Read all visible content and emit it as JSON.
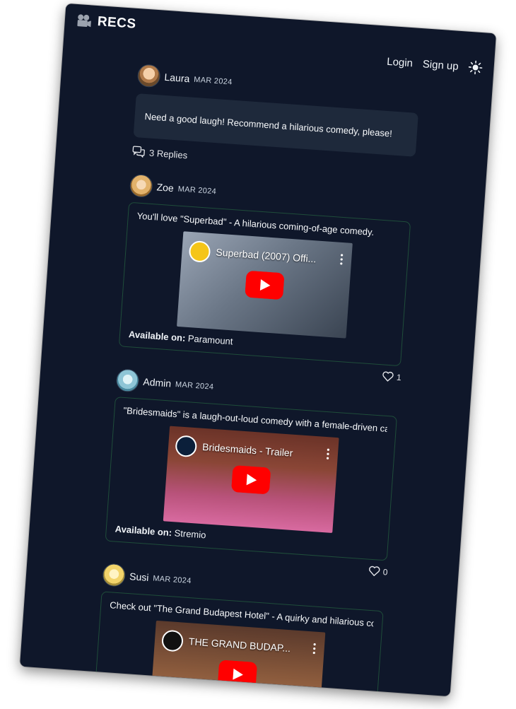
{
  "app": {
    "title": "RECS"
  },
  "nav": {
    "login": "Login",
    "signup": "Sign up"
  },
  "question": {
    "author": "Laura",
    "date": "MAR 2024",
    "text": "Need a good laugh! Recommend a hilarious comedy, please!",
    "replies_label": "3 Replies"
  },
  "replies": [
    {
      "author": "Zoe",
      "date": "MAR 2024",
      "text": "You'll love \"Superbad\" - A hilarious coming-of-age comedy.",
      "video_title": "Superbad (2007) Offi...",
      "available_label": "Available on:",
      "platform": "Paramount",
      "likes": "1"
    },
    {
      "author": "Admin",
      "date": "MAR 2024",
      "text": "\"Bridesmaids\" is a laugh-out-loud comedy with a female-driven cast.",
      "video_title": "Bridesmaids - Trailer",
      "available_label": "Available on:",
      "platform": "Stremio",
      "likes": "0"
    },
    {
      "author": "Susi",
      "date": "MAR 2024",
      "text": "Check out \"The Grand Budapest Hotel\" - A quirky and hilarious comedy.",
      "video_title": "THE GRAND BUDAP...",
      "available_label": "",
      "platform": ""
    }
  ],
  "colors": {
    "background": "#0f172a",
    "card": "#1e293b",
    "card_border": "#1f4d3a",
    "play_red": "#ff0000"
  }
}
